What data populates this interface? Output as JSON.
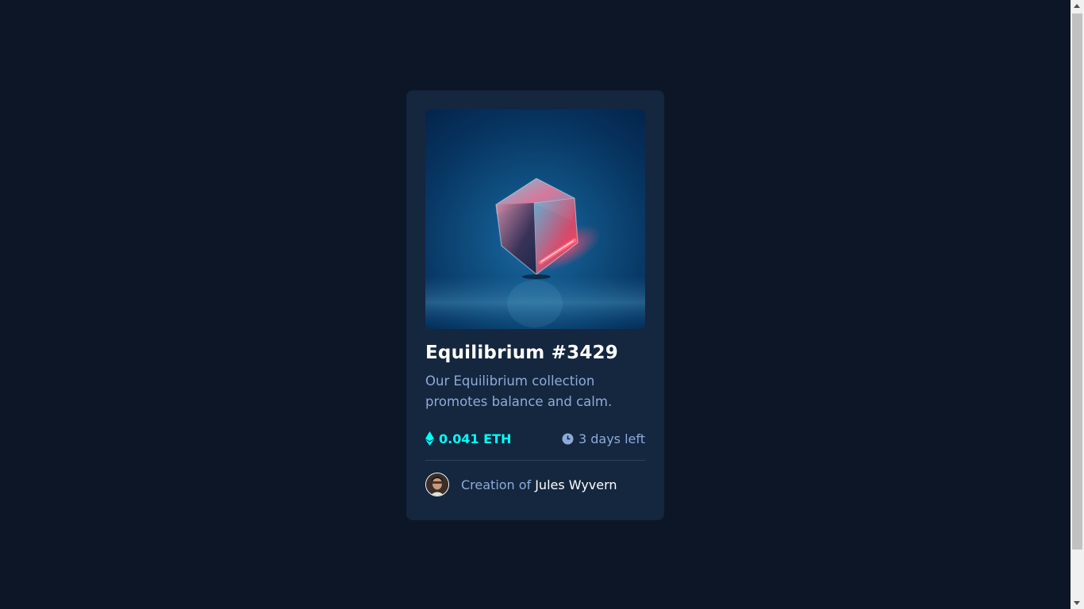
{
  "card": {
    "title": "Equilibrium #3429",
    "description": "Our Equilibrium collection promotes balance and calm.",
    "price": "0.041 ETH",
    "time_left": "3 days left",
    "creator_prefix": "Creation of",
    "creator_name": "Jules Wyvern"
  },
  "icons": {
    "price": "ethereum-icon",
    "time": "clock-icon",
    "avatar": "avatar"
  },
  "colors": {
    "page_bg": "#0d1627",
    "card_bg": "#15263f",
    "accent_cyan": "#00fff8",
    "soft_blue": "#8bacd9",
    "white": "#ffffff",
    "divider": "#2e405a"
  }
}
